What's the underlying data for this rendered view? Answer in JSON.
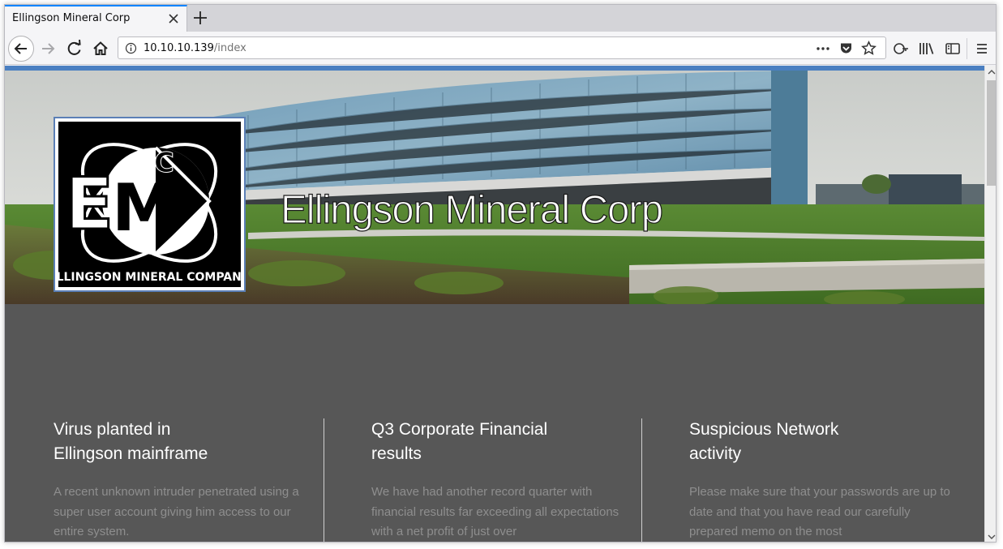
{
  "browser": {
    "tab": {
      "title": "Ellingson Mineral Corp"
    },
    "url": {
      "host": "10.10.10.139",
      "path": "/index"
    }
  },
  "hero": {
    "title": "Ellingson Mineral Corp",
    "logo": {
      "monogram": "EMC",
      "caption": "ELLINGSON MINERAL COMPANY"
    }
  },
  "articles": [
    {
      "heading": "Virus planted in\nEllingson mainframe",
      "body": "A recent unknown intruder penetrated using a super user account giving him access to our entire system."
    },
    {
      "heading": "Q3 Corporate Financial\nresults",
      "body": "We have had another record quarter with financial results far exceeding all expectations with a net profit of just over"
    },
    {
      "heading": "Suspicious Network\nactivity",
      "body": "Please make sure that your passwords are up to date and that you have read our carefully prepared memo on the most"
    }
  ],
  "colors": {
    "accent": "#4a7fc1",
    "section_background": "#575757"
  }
}
